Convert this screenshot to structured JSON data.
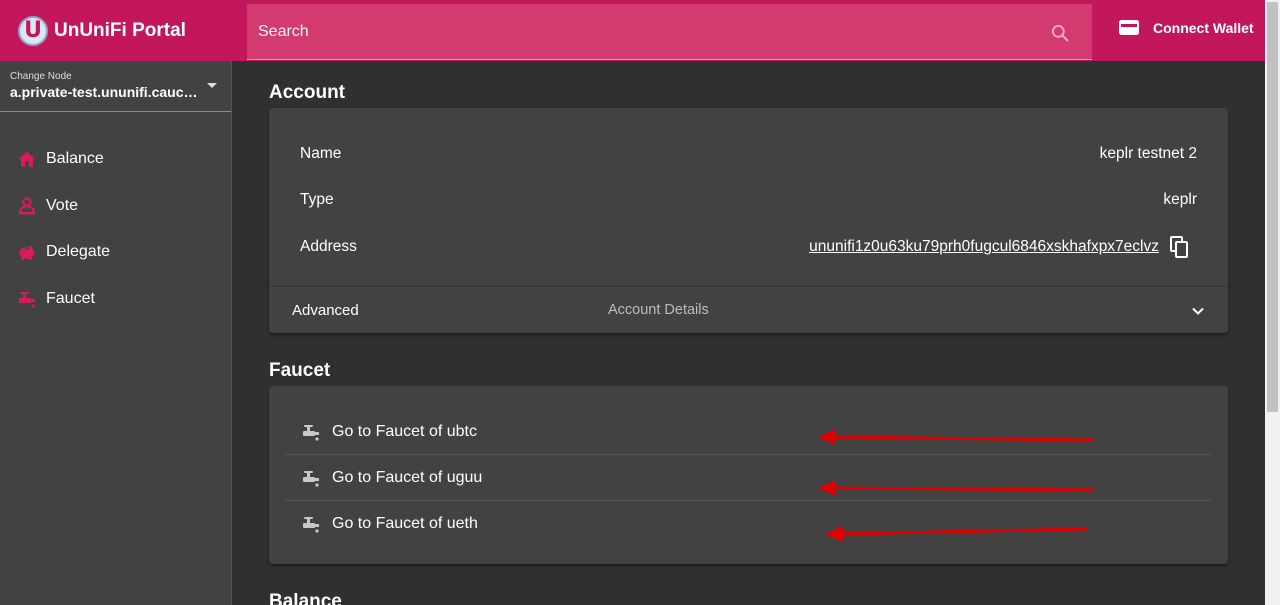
{
  "app": {
    "logo_letter": "U",
    "title": "UnUniFi Portal"
  },
  "search": {
    "placeholder": "Search"
  },
  "wallet": {
    "label": "Connect Wallet"
  },
  "node": {
    "label": "Change Node",
    "value": "a.private-test.ununifi.cauchye...."
  },
  "sidebar": {
    "items": [
      {
        "label": "Balance",
        "icon": "home-icon"
      },
      {
        "label": "Vote",
        "icon": "vote-icon"
      },
      {
        "label": "Delegate",
        "icon": "piggy-bank-icon"
      },
      {
        "label": "Faucet",
        "icon": "faucet-icon"
      }
    ]
  },
  "account": {
    "title": "Account",
    "rows": [
      {
        "label": "Name",
        "value": "keplr testnet 2"
      },
      {
        "label": "Type",
        "value": "keplr"
      },
      {
        "label": "Address",
        "value": "ununifi1z0u63ku79prh0fugcul6846xskhafxpx7eclvz"
      }
    ],
    "advanced": {
      "title": "Advanced",
      "description": "Account Details"
    }
  },
  "faucet": {
    "title": "Faucet",
    "items": [
      {
        "label": "Go to Faucet of ubtc"
      },
      {
        "label": "Go to Faucet of uguu"
      },
      {
        "label": "Go to Faucet of ueth"
      }
    ]
  },
  "balance": {
    "title": "Balance"
  },
  "colors": {
    "accent": "#c2185b",
    "sidebar_bg": "#424242",
    "page_bg": "#303030",
    "annotation_arrow": "#e00000"
  }
}
